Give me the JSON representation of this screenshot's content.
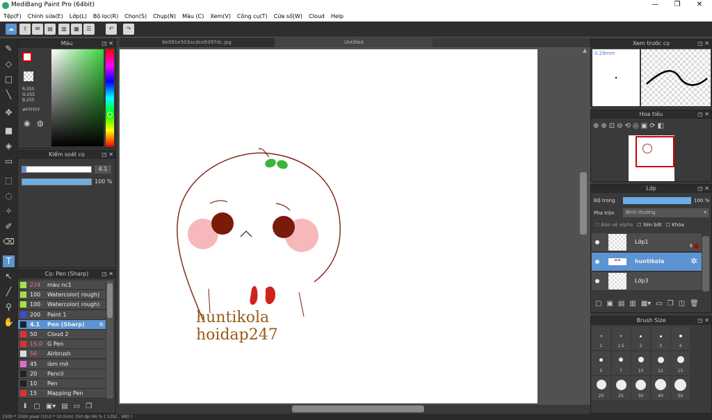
{
  "window": {
    "title": "MediBang Paint Pro (64bit)"
  },
  "menu": [
    "Tệp(F)",
    "Chỉnh sửa(E)",
    "Lớp(L)",
    "Bộ lọc(R)",
    "Chọn(S)",
    "Chụp(N)",
    "Màu (C)",
    "Xem(V)",
    "Công cụ(T)",
    "Cửa sổ(W)",
    "Cloud",
    "Help"
  ],
  "tabs": {
    "file1": "6e991e503acdce9397dc.jpg",
    "file2": "Untitled"
  },
  "color_panel": {
    "title": "Màu",
    "r": "R:255",
    "g": "G:255",
    "b": "B:255",
    "hex": "#FFFFFF"
  },
  "brush_control": {
    "title": "Kiểm soát cọ",
    "size": "4.1",
    "opacity": "100 %"
  },
  "brush_list": {
    "title": "Cọ: Pen (Sharp)",
    "items": [
      {
        "size": "224",
        "name": "màu nc1",
        "color": "#a9e04a"
      },
      {
        "size": "100",
        "name": "Watercolor( rough)",
        "color": "#a9e04a"
      },
      {
        "size": "100",
        "name": "Watercolor( rough)",
        "color": "#a9e04a"
      },
      {
        "size": "200",
        "name": "Paint 1",
        "color": "#3b4ed4"
      },
      {
        "size": "4.1",
        "name": "Pen (Sharp)",
        "color": "#222222"
      },
      {
        "size": "50",
        "name": "Cloud 2",
        "color": "#e03030"
      },
      {
        "size": "15.0",
        "name": "G Pen",
        "color": "#e03030"
      },
      {
        "size": "56",
        "name": "Airbrush",
        "color": "#dddddd"
      },
      {
        "size": "45",
        "name": "làm mờ",
        "color": "#e070d0"
      },
      {
        "size": "20",
        "name": "Pencil",
        "color": "#222222"
      },
      {
        "size": "10",
        "name": "Pen",
        "color": "#222222"
      },
      {
        "size": "15",
        "name": "Mapping Pen",
        "color": "#e03030"
      }
    ]
  },
  "canvas_text": {
    "line1": "huntikola",
    "line2": "hoidap247"
  },
  "preview": {
    "title": "Xem trước cọ",
    "size": "0.29mm"
  },
  "navigator": {
    "title": "Hoa tiêu"
  },
  "layer_panel": {
    "title": "Lớp",
    "opacity_label": "Độ trong",
    "opacity_value": "100 %",
    "blend_label": "Pha trộn",
    "blend_value": "Bình thường",
    "protect_alpha": "Bảo vệ alpha",
    "clip": "Xén bớt",
    "lock": "Khóa",
    "layers": [
      {
        "name": "Lớp1",
        "badge": "8"
      },
      {
        "name": "huntikola",
        "badge": ""
      },
      {
        "name": "Lớp3",
        "badge": ""
      }
    ]
  },
  "brush_size": {
    "title": "Brush Size",
    "labels": [
      "1",
      "1.5",
      "2",
      "3",
      "4",
      "5",
      "7",
      "10",
      "12",
      "15",
      "20",
      "25",
      "30",
      "40",
      "50"
    ]
  },
  "status": {
    "text": "1500 * 1500 pixel   (10.0 * 10.0cm)   350 dpi   66 %   ( 1292 , 680 )"
  },
  "colors": {
    "accent": "#5c94d3",
    "bg": "#3a3a3a",
    "ink": "#7a1e0e",
    "text_brown": "#9a5a1a"
  }
}
